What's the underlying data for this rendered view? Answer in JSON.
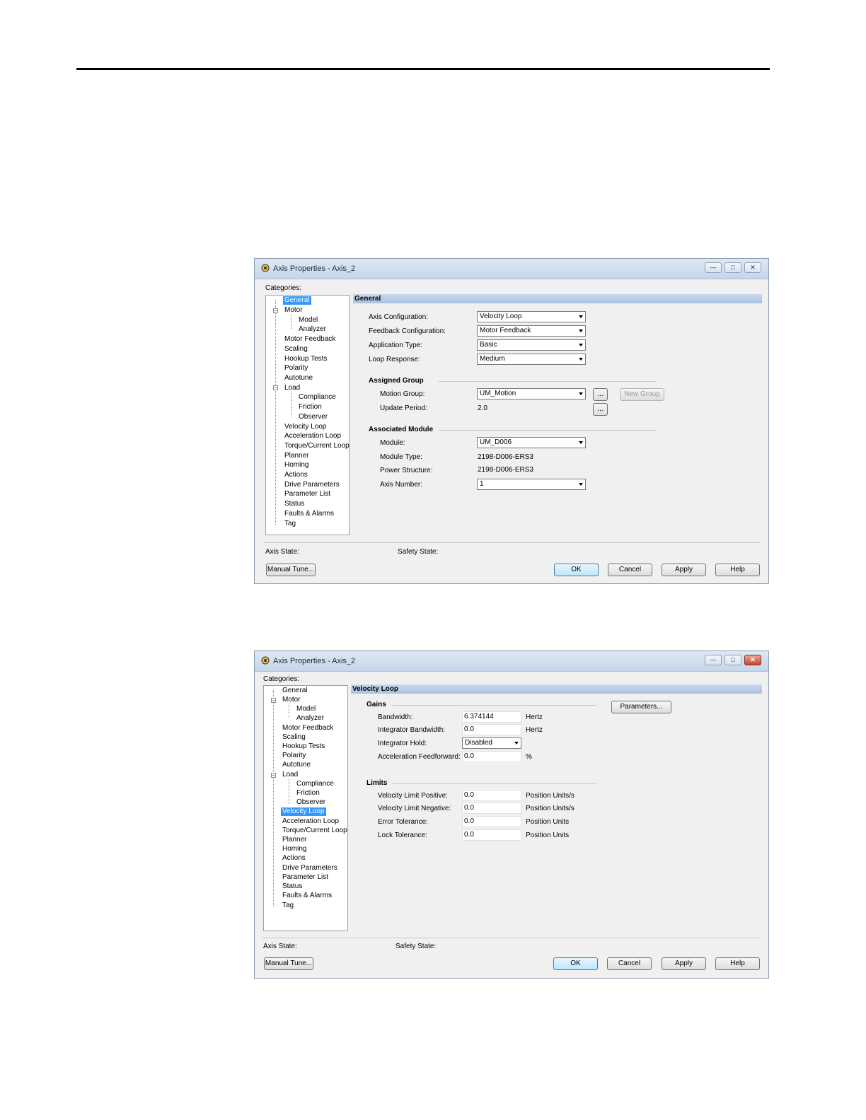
{
  "dialog1": {
    "title": "Axis Properties - Axis_2",
    "categories_label": "Categories:",
    "tree": [
      "General",
      "Motor",
      "Model",
      "Analyzer",
      "Motor Feedback",
      "Scaling",
      "Hookup Tests",
      "Polarity",
      "Autotune",
      "Load",
      "Compliance",
      "Friction",
      "Observer",
      "Velocity Loop",
      "Acceleration Loop",
      "Torque/Current Loop",
      "Planner",
      "Homing",
      "Actions",
      "Drive Parameters",
      "Parameter List",
      "Status",
      "Faults & Alarms",
      "Tag"
    ],
    "selected": "General",
    "section": "General",
    "fields": {
      "axis_config_label": "Axis Configuration:",
      "axis_config_value": "Velocity Loop",
      "feedback_config_label": "Feedback Configuration:",
      "feedback_config_value": "Motor Feedback",
      "app_type_label": "Application Type:",
      "app_type_value": "Basic",
      "loop_response_label": "Loop Response:",
      "loop_response_value": "Medium"
    },
    "assigned_group": {
      "title": "Assigned Group",
      "motion_group_label": "Motion Group:",
      "motion_group_value": "UM_Motion",
      "ellipsis": "...",
      "new_group": "New Group",
      "update_period_label": "Update Period:",
      "update_period_value": "2.0"
    },
    "associated_module": {
      "title": "Associated Module",
      "module_label": "Module:",
      "module_value": "UM_D006",
      "module_type_label": "Module Type:",
      "module_type_value": "2198-D006-ERS3",
      "power_structure_label": "Power Structure:",
      "power_structure_value": "2198-D006-ERS3",
      "axis_number_label": "Axis Number:",
      "axis_number_value": "1"
    },
    "axis_state_label": "Axis State:",
    "safety_state_label": "Safety State:",
    "buttons": {
      "manual_tune": "Manual Tune...",
      "ok": "OK",
      "cancel": "Cancel",
      "apply": "Apply",
      "help": "Help"
    }
  },
  "dialog2": {
    "title": "Axis Properties - Axis_2",
    "categories_label": "Categories:",
    "tree": [
      "General",
      "Motor",
      "Model",
      "Analyzer",
      "Motor Feedback",
      "Scaling",
      "Hookup Tests",
      "Polarity",
      "Autotune",
      "Load",
      "Compliance",
      "Friction",
      "Observer",
      "Velocity Loop",
      "Acceleration Loop",
      "Torque/Current Loop",
      "Planner",
      "Homing",
      "Actions",
      "Drive Parameters",
      "Parameter List",
      "Status",
      "Faults & Alarms",
      "Tag"
    ],
    "selected": "Velocity Loop",
    "section": "Velocity Loop",
    "gains": {
      "title": "Gains",
      "parameters_button": "Parameters...",
      "bandwidth_label": "Bandwidth:",
      "bandwidth_value": "6.374144",
      "bandwidth_unit": "Hertz",
      "int_bandwidth_label": "Integrator Bandwidth:",
      "int_bandwidth_value": "0.0",
      "int_bandwidth_unit": "Hertz",
      "int_hold_label": "Integrator Hold:",
      "int_hold_value": "Disabled",
      "accel_ff_label": "Acceleration Feedforward:",
      "accel_ff_value": "0.0",
      "accel_ff_unit": "%"
    },
    "limits": {
      "title": "Limits",
      "vel_pos_label": "Velocity Limit Positive:",
      "vel_pos_value": "0.0",
      "vel_pos_unit": "Position Units/s",
      "vel_neg_label": "Velocity Limit Negative:",
      "vel_neg_value": "0.0",
      "vel_neg_unit": "Position Units/s",
      "err_tol_label": "Error Tolerance:",
      "err_tol_value": "0.0",
      "err_tol_unit": "Position Units",
      "lock_tol_label": "Lock Tolerance:",
      "lock_tol_value": "0.0",
      "lock_tol_unit": "Position Units"
    },
    "axis_state_label": "Axis State:",
    "safety_state_label": "Safety State:",
    "buttons": {
      "manual_tune": "Manual Tune...",
      "ok": "OK",
      "cancel": "Cancel",
      "apply": "Apply",
      "help": "Help"
    }
  }
}
